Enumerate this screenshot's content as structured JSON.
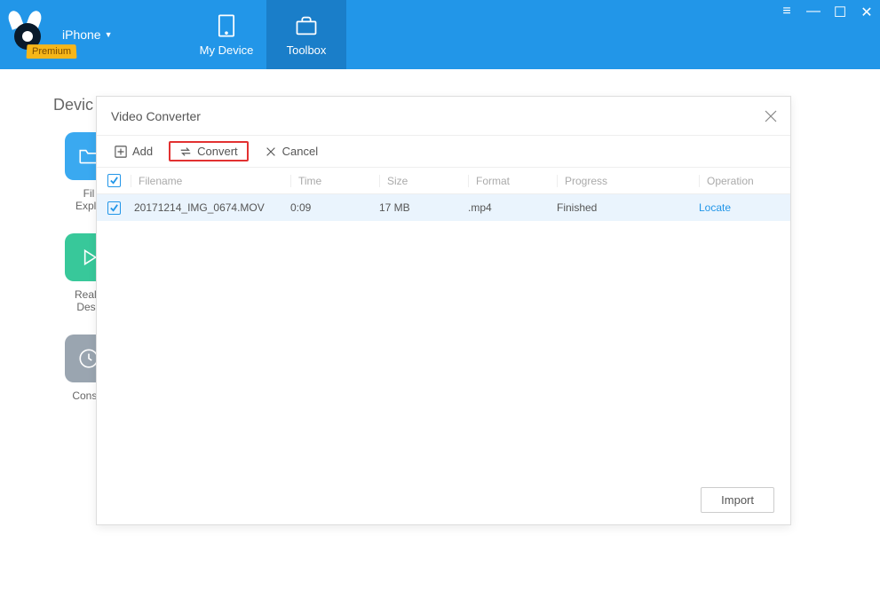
{
  "header": {
    "premium_label": "Premium",
    "device_name": "iPhone",
    "tabs": {
      "my_device": "My Device",
      "toolbox": "Toolbox"
    }
  },
  "body": {
    "section_title": "Devic",
    "tiles": {
      "file_explorer": "Fil\nExplo",
      "real_time_desktop": "Real-t\nDesk",
      "console": "Consol"
    }
  },
  "dialog": {
    "title": "Video Converter",
    "toolbar": {
      "add": "Add",
      "convert": "Convert",
      "cancel": "Cancel"
    },
    "columns": {
      "filename": "Filename",
      "time": "Time",
      "size": "Size",
      "format": "Format",
      "progress": "Progress",
      "operation": "Operation"
    },
    "rows": [
      {
        "checked": true,
        "filename": "20171214_IMG_0674.MOV",
        "time": "0:09",
        "size": "17 MB",
        "format": ".mp4",
        "progress": "Finished",
        "operation": "Locate"
      }
    ],
    "footer": {
      "import": "Import"
    }
  }
}
